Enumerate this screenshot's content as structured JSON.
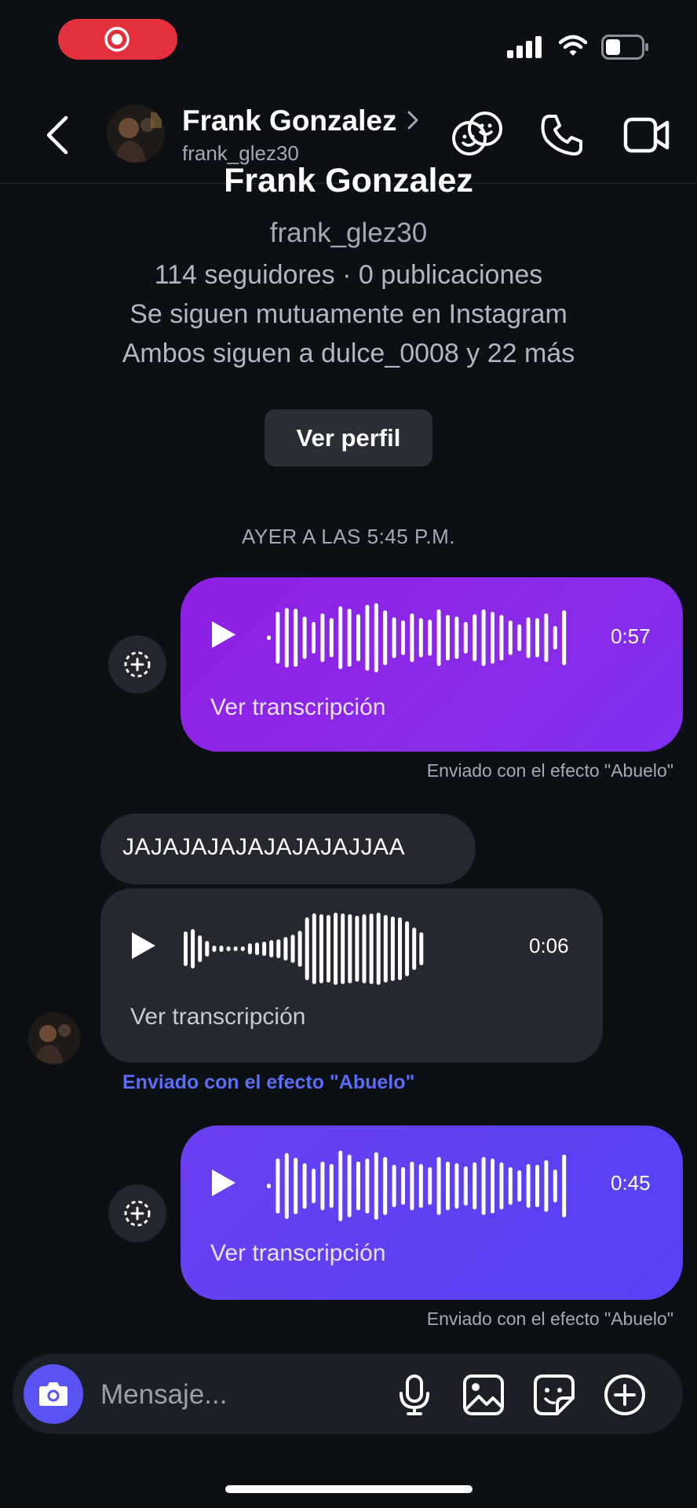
{
  "header": {
    "contact_name": "Frank Gonzalez",
    "contact_username": "frank_glez30"
  },
  "profile": {
    "name": "Frank Gonzalez",
    "username": "frank_glez30",
    "stats": "114 seguidores · 0 publicaciones",
    "mutual": "Se siguen mutuamente en Instagram",
    "followers_in_common": "Ambos siguen a dulce_0008 y 22 más",
    "view_profile_label": "Ver perfil"
  },
  "thread": {
    "timestamp": "AYER A LAS 5:45 P.M.",
    "messages": [
      {
        "type": "voice",
        "direction": "outgoing",
        "duration": "0:57",
        "transcription_label": "Ver transcripción",
        "effect_note": "Enviado con el efecto \"Abuelo\""
      },
      {
        "type": "text",
        "direction": "incoming",
        "text": "JAJAJAJAJAJAJAJAJJAA"
      },
      {
        "type": "voice",
        "direction": "incoming",
        "duration": "0:06",
        "transcription_label": "Ver transcripción",
        "effect_note": "Enviado con el efecto \"Abuelo\""
      },
      {
        "type": "voice",
        "direction": "outgoing",
        "duration": "0:45",
        "transcription_label": "Ver transcripción",
        "effect_note": "Enviado con el efecto \"Abuelo\""
      }
    ]
  },
  "composer": {
    "placeholder": "Mensaje...",
    "icons": [
      "camera-icon",
      "microphone-icon",
      "gallery-icon",
      "sticker-icon",
      "plus-icon"
    ]
  },
  "colors": {
    "background": "#0c0f14",
    "outgoing_bubble_1": "#8a2be8",
    "outgoing_bubble_2": "#5c41f3",
    "incoming_bubble": "#25282e",
    "recording_indicator": "#e3303d",
    "effect_link": "#5b6cf5"
  }
}
